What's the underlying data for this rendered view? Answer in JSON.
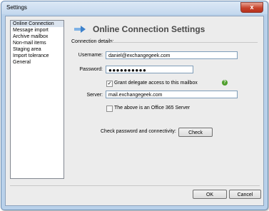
{
  "window": {
    "title": "Settings",
    "close_glyph": "x"
  },
  "nav": {
    "items": [
      {
        "label": "Online Connection",
        "selected": true
      },
      {
        "label": "Message import"
      },
      {
        "label": "Archive mailbox"
      },
      {
        "label": "Non-mail items"
      },
      {
        "label": "Staging area"
      },
      {
        "label": "Import tolerance"
      },
      {
        "label": "General"
      }
    ]
  },
  "header": {
    "title": "Online Connection Settings",
    "icon": "connection-arrow-icon"
  },
  "connection": {
    "section_label": "Connection details:",
    "username_label": "Username:",
    "username_value": "daniel@exchangegeek.com",
    "password_label": "Password:",
    "password_value": "●●●●●●●●●●",
    "delegate_label": "Grant delegate access to this mailbox",
    "delegate_checked": true,
    "help_glyph": "?",
    "server_label": "Server:",
    "server_value": "mail.exchangegeek.com",
    "office365_label": "The above is an Office 365 Server",
    "office365_checked": false
  },
  "check": {
    "label": "Check password and connectivity:",
    "button_label": "Check"
  },
  "footer": {
    "ok_label": "OK",
    "cancel_label": "Cancel"
  },
  "colors": {
    "title_bar": "#c4d8ee",
    "close_button": "#c7432c",
    "help_icon": "#4f9f2d"
  }
}
